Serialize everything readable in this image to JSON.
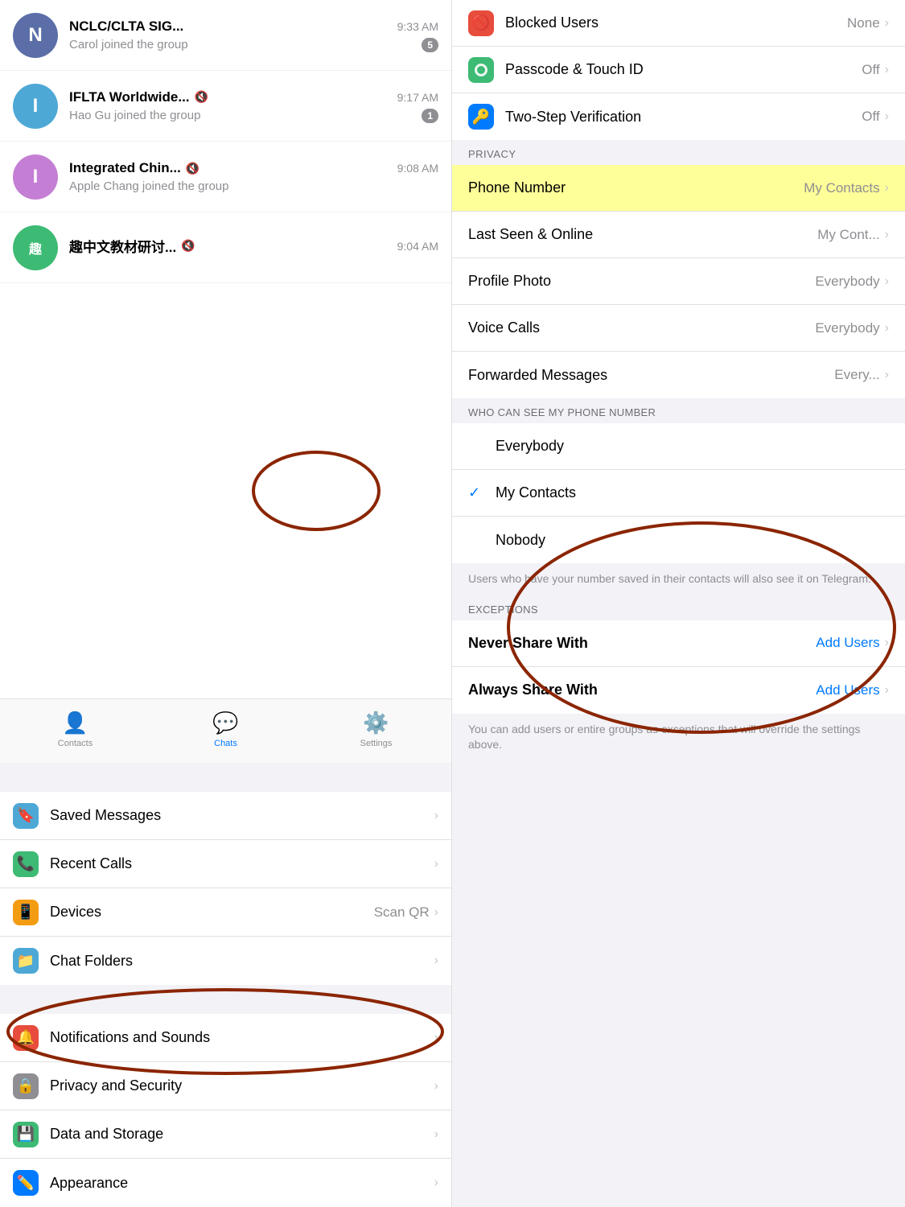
{
  "left": {
    "chats": [
      {
        "id": "nclc",
        "name": "NCLC/CLTA SIG...",
        "preview": "Carol joined the group",
        "time": "9:33 AM",
        "avatarColor": "#5b6ea8",
        "avatarLetter": "N",
        "badge": "5",
        "muted": false
      },
      {
        "id": "iflta",
        "name": "IFLTA Worldwide...",
        "preview": "Hao Gu joined the group",
        "time": "9:17 AM",
        "avatarColor": "#4da8d6",
        "avatarLetter": "I",
        "badge": "1",
        "muted": true
      },
      {
        "id": "integrated",
        "name": "Integrated Chin...",
        "preview": "Apple Chang joined the group",
        "time": "9:08 AM",
        "avatarColor": "#c47fd4",
        "avatarLetter": "I",
        "badge": "",
        "muted": true
      },
      {
        "id": "quzw",
        "name": "趣中文教材研讨...",
        "preview": "",
        "time": "9:04 AM",
        "avatarColor": "#3dba74",
        "avatarLetter": "趣",
        "badge": "",
        "muted": true
      }
    ],
    "tabs": [
      {
        "id": "contacts",
        "label": "Contacts",
        "icon": "👤",
        "active": false
      },
      {
        "id": "chats",
        "label": "Chats",
        "icon": "💬",
        "active": true
      },
      {
        "id": "settings",
        "label": "Settings",
        "icon": "⚙️",
        "active": false
      }
    ],
    "settings": [
      {
        "id": "saved-messages",
        "label": "Saved Messages",
        "icon": "🔖",
        "iconBg": "#4da8d6",
        "value": "",
        "chevron": true
      },
      {
        "id": "recent-calls",
        "label": "Recent Calls",
        "icon": "📞",
        "iconBg": "#3dba74",
        "value": "",
        "chevron": true
      },
      {
        "id": "devices",
        "label": "Devices",
        "icon": "📱",
        "iconBg": "#f39c12",
        "value": "Scan QR",
        "chevron": true
      },
      {
        "id": "chat-folders",
        "label": "Chat Folders",
        "icon": "📁",
        "iconBg": "#4da8d6",
        "value": "",
        "chevron": true
      },
      {
        "id": "notifications",
        "label": "Notifications and Sounds",
        "icon": "🔔",
        "iconBg": "#e74c3c",
        "value": "",
        "chevron": true
      },
      {
        "id": "privacy",
        "label": "Privacy and Security",
        "icon": "🔒",
        "iconBg": "#8e8e93",
        "value": "",
        "chevron": true
      },
      {
        "id": "data-storage",
        "label": "Data and Storage",
        "icon": "💾",
        "iconBg": "#3dba74",
        "value": "",
        "chevron": true
      },
      {
        "id": "appearance",
        "label": "Appearance",
        "icon": "✏️",
        "iconBg": "#007aff",
        "value": "",
        "chevron": true
      }
    ]
  },
  "right": {
    "security_items": [
      {
        "id": "blocked-users",
        "label": "Blocked Users",
        "icon": "🚫",
        "iconBg": "#e74c3c",
        "value": "None"
      },
      {
        "id": "passcode",
        "label": "Passcode & Touch ID",
        "icon": "🟢",
        "iconBg": "#3dba74",
        "value": "Off"
      },
      {
        "id": "two-step",
        "label": "Two-Step Verification",
        "icon": "🔑",
        "iconBg": "#007aff",
        "value": "Off"
      }
    ],
    "privacy_section_label": "PRIVACY",
    "privacy_items": [
      {
        "id": "phone-number",
        "label": "Phone Number",
        "value": "My Contacts",
        "highlighted": true
      },
      {
        "id": "last-seen",
        "label": "Last Seen & Online",
        "value": "My Cont..."
      },
      {
        "id": "profile-photo",
        "label": "Profile Photo",
        "value": "Everybody"
      },
      {
        "id": "voice-calls",
        "label": "Voice Calls",
        "value": "Everybody"
      },
      {
        "id": "forwarded-messages",
        "label": "Forwarded Messages",
        "value": "Every..."
      }
    ],
    "who_section_label": "WHO CAN SEE MY PHONE NUMBER",
    "who_options": [
      {
        "id": "everybody",
        "label": "Everybody",
        "selected": false
      },
      {
        "id": "my-contacts",
        "label": "My Contacts",
        "selected": true
      },
      {
        "id": "nobody",
        "label": "Nobody",
        "selected": false
      }
    ],
    "who_description": "Users who have your number saved in their contacts will also see it on Telegram.",
    "exceptions_label": "EXCEPTIONS",
    "exceptions": [
      {
        "id": "never-share",
        "label": "Never Share With",
        "value": "Add Users"
      },
      {
        "id": "always-share",
        "label": "Always Share With",
        "value": "Add Users"
      }
    ],
    "bottom_description": "You can add users or entire groups as exceptions that will override the settings above."
  }
}
